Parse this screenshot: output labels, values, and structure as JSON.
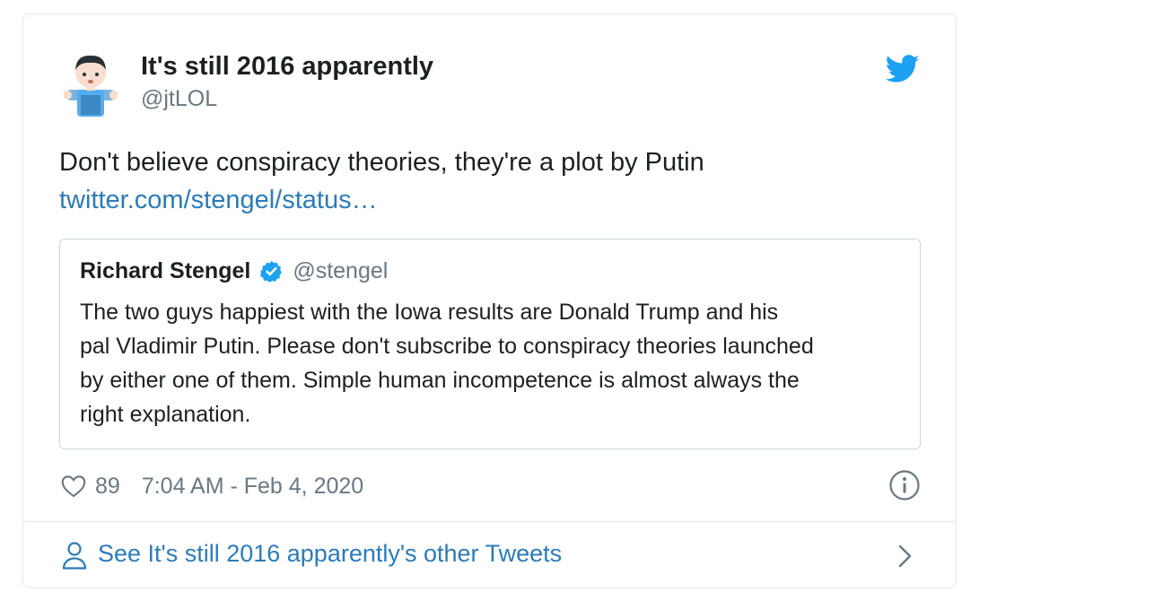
{
  "author": {
    "name": "It's still 2016 apparently",
    "handle": "@jtLOL",
    "avatar_icon": "emoji-person-avatar"
  },
  "brand": {
    "icon": "twitter-bird-icon",
    "color": "#1da1f2"
  },
  "tweet": {
    "text": "Don't believe conspiracy theories, they're a plot by Putin",
    "link": "twitter.com/stengel/status…"
  },
  "quoted_tweet": {
    "name": "Richard Stengel",
    "verified_icon": "verified-badge-icon",
    "handle": "@stengel",
    "lines": [
      "The two guys happiest with the Iowa results are Donald Trump and his",
      "pal Vladimir Putin. Please don't subscribe to conspiracy theories launched",
      "by either one of them. Simple human incompetence is almost always the",
      "right explanation."
    ]
  },
  "meta": {
    "like_icon": "heart-icon",
    "like_count": "89",
    "timestamp": "7:04 AM - Feb 4, 2020",
    "info_icon": "info-icon"
  },
  "footer": {
    "icon": "person-icon",
    "label": "See It's still 2016 apparently's other Tweets",
    "chevron_icon": "chevron-right-icon"
  },
  "colors": {
    "link": "#2b7bb9",
    "secondary_text": "#697882",
    "primary_text": "#1c2022",
    "border": "#e1e8ed",
    "verified": "#1da1f2"
  }
}
